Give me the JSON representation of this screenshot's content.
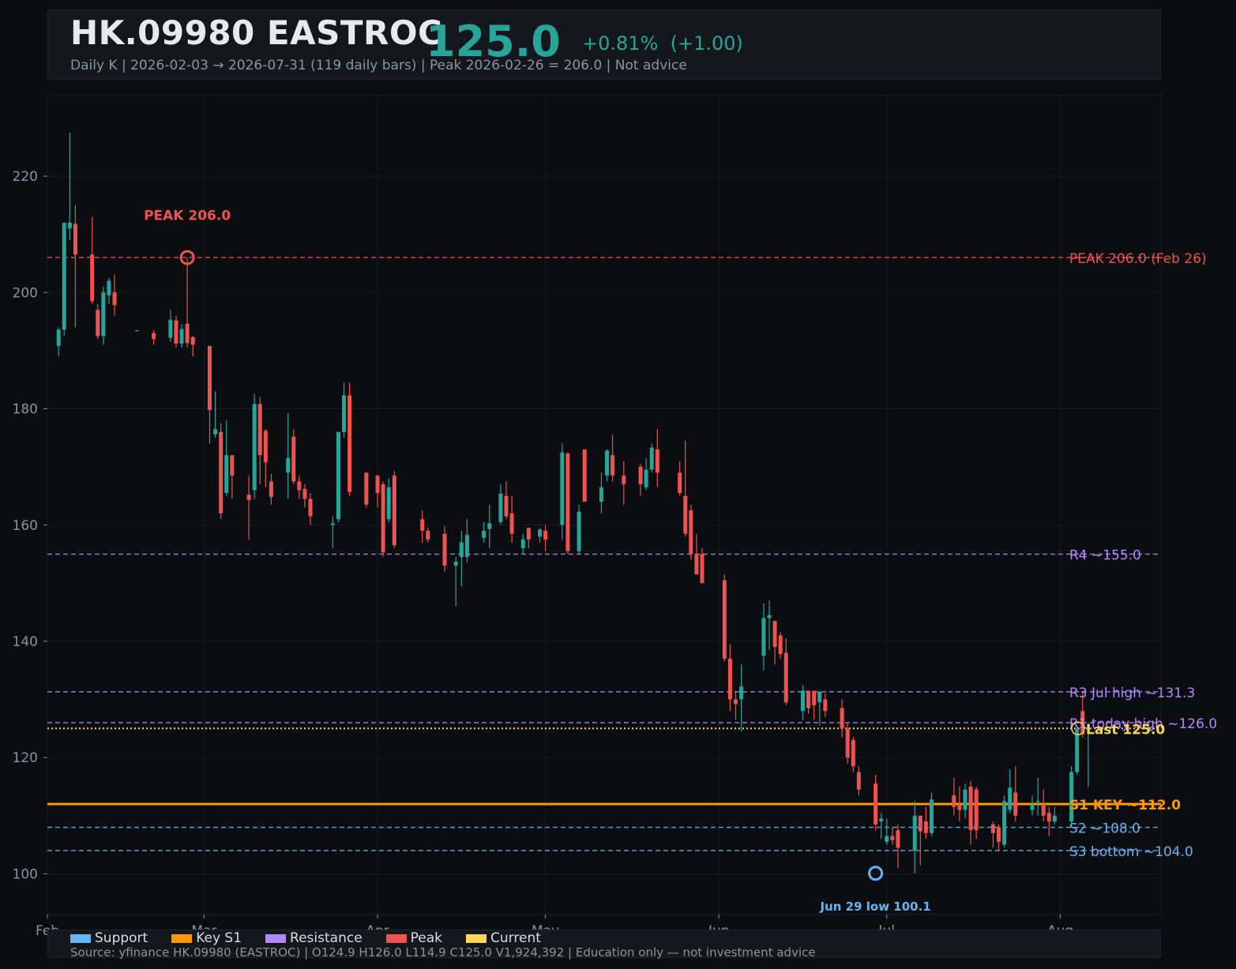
{
  "header": {
    "title": "HK.09980  EASTROC",
    "price": "125.0",
    "change": "+0.81%  (+1.00)",
    "subtitle": "Daily K  |  2026-02-03 → 2026-07-31 (119 daily bars)  |  Peak 2026-02-26 = 206.0  |  Not advice"
  },
  "footer": {
    "legend": [
      {
        "label": "Support",
        "color": "#64b5f6"
      },
      {
        "label": "Key S1",
        "color": "#ff9800"
      },
      {
        "label": "Resistance",
        "color": "#b388ff"
      },
      {
        "label": "Peak",
        "color": "#ef5350"
      },
      {
        "label": "Current",
        "color": "#ffd54f"
      }
    ],
    "source": "Source: yfinance HK.09980 (EASTROC)  |  O124.9  H126.0  L114.9  C125.0  V1,924,392  |  Education only — not investment advice"
  },
  "colors": {
    "up": "#26a69a",
    "down": "#ef5350",
    "support": "#64b5f6",
    "key": "#ff9800",
    "resistance": "#b388ff",
    "peak": "#ef5350",
    "current": "#ffd54f"
  },
  "chart_data": {
    "type": "candlestick",
    "ylim": [
      93,
      234
    ],
    "y_ticks": [
      100,
      120,
      140,
      160,
      180,
      200,
      220
    ],
    "x_range": [
      "2026-02-01",
      "2026-08-19"
    ],
    "x_ticks": [
      {
        "date": "2026-02-01",
        "label": "Feb"
      },
      {
        "date": "2026-03-01",
        "label": "Mar"
      },
      {
        "date": "2026-04-01",
        "label": "Apr"
      },
      {
        "date": "2026-05-01",
        "label": "May"
      },
      {
        "date": "2026-06-01",
        "label": "Jun"
      },
      {
        "date": "2026-07-01",
        "label": "Jul"
      },
      {
        "date": "2026-08-01",
        "label": "Aug"
      }
    ],
    "levels": [
      {
        "label": "PEAK 206.0 (Feb 26)",
        "value": 206.0,
        "kind": "peak",
        "style": "dashed"
      },
      {
        "label": "R4 ~155.0",
        "value": 155.0,
        "kind": "resistance",
        "style": "dashed"
      },
      {
        "label": "R3 Jul high ~131.3",
        "value": 131.3,
        "kind": "resistance",
        "style": "dashed"
      },
      {
        "label": "R1 today high ~126.0",
        "value": 126.0,
        "kind": "resistance",
        "style": "dashed"
      },
      {
        "label": "Last 125.0",
        "value": 125.0,
        "kind": "current",
        "style": "dotted"
      },
      {
        "label": "S1 KEY ~112.0",
        "value": 112.0,
        "kind": "key",
        "style": "solid"
      },
      {
        "label": "S2 ~108.0",
        "value": 108.0,
        "kind": "support",
        "style": "dashed"
      },
      {
        "label": "S3 bottom ~104.0",
        "value": 104.0,
        "kind": "support",
        "style": "dashed"
      }
    ],
    "annotations": [
      {
        "label": "PEAK 206.0",
        "date": "2026-02-26",
        "value": 206.0,
        "kind": "peak"
      },
      {
        "label": "Jun 29 low 100.1",
        "date": "2026-06-29",
        "value": 100.1,
        "kind": "support"
      }
    ],
    "candles": [
      {
        "d": "2026-02-03",
        "o": 190.8,
        "h": 194.0,
        "l": 189.0,
        "c": 193.6
      },
      {
        "d": "2026-02-04",
        "o": 193.6,
        "h": 212.0,
        "l": 192.5,
        "c": 212.0
      },
      {
        "d": "2026-02-05",
        "o": 211.0,
        "h": 227.5,
        "l": 209.0,
        "c": 212.0
      },
      {
        "d": "2026-02-06",
        "o": 211.8,
        "h": 215.0,
        "l": 194.0,
        "c": 206.5
      },
      {
        "d": "2026-02-09",
        "o": 206.5,
        "h": 213.0,
        "l": 198.0,
        "c": 198.5
      },
      {
        "d": "2026-02-10",
        "o": 197.0,
        "h": 198.0,
        "l": 192.0,
        "c": 192.5
      },
      {
        "d": "2026-02-11",
        "o": 192.5,
        "h": 201.0,
        "l": 191.0,
        "c": 200.0
      },
      {
        "d": "2026-02-12",
        "o": 199.5,
        "h": 202.5,
        "l": 198.0,
        "c": 202.0
      },
      {
        "d": "2026-02-13",
        "o": 200.0,
        "h": 203.0,
        "l": 196.0,
        "c": 197.8
      },
      {
        "d": "2026-02-17",
        "o": 193.5,
        "h": 193.5,
        "l": 193.4,
        "c": 193.5
      },
      {
        "d": "2026-02-20",
        "o": 193.0,
        "h": 193.5,
        "l": 191.0,
        "c": 192.0
      },
      {
        "d": "2026-02-23",
        "o": 192.2,
        "h": 197.0,
        "l": 191.5,
        "c": 195.3
      },
      {
        "d": "2026-02-24",
        "o": 195.2,
        "h": 196.0,
        "l": 190.5,
        "c": 191.2
      },
      {
        "d": "2026-02-25",
        "o": 191.2,
        "h": 194.5,
        "l": 190.5,
        "c": 193.7
      },
      {
        "d": "2026-02-26",
        "o": 194.6,
        "h": 206.0,
        "l": 190.5,
        "c": 191.3
      },
      {
        "d": "2026-02-27",
        "o": 192.3,
        "h": 192.5,
        "l": 189.0,
        "c": 191.0
      },
      {
        "d": "2026-03-02",
        "o": 190.8,
        "h": 190.8,
        "l": 174.0,
        "c": 179.8
      },
      {
        "d": "2026-03-03",
        "o": 175.6,
        "h": 183.0,
        "l": 175.0,
        "c": 176.5
      },
      {
        "d": "2026-03-04",
        "o": 176.0,
        "h": 177.5,
        "l": 161.0,
        "c": 162.0
      },
      {
        "d": "2026-03-05",
        "o": 165.5,
        "h": 178.0,
        "l": 165.0,
        "c": 172.0
      },
      {
        "d": "2026-03-06",
        "o": 172.0,
        "h": 172.0,
        "l": 164.5,
        "c": 168.5
      },
      {
        "d": "2026-03-09",
        "o": 165.2,
        "h": 168.5,
        "l": 157.5,
        "c": 164.3
      },
      {
        "d": "2026-03-10",
        "o": 166.0,
        "h": 182.5,
        "l": 164.5,
        "c": 180.8
      },
      {
        "d": "2026-03-11",
        "o": 180.8,
        "h": 182.0,
        "l": 167.0,
        "c": 172.0
      },
      {
        "d": "2026-03-12",
        "o": 176.2,
        "h": 176.5,
        "l": 166.5,
        "c": 170.8
      },
      {
        "d": "2026-03-13",
        "o": 167.5,
        "h": 168.8,
        "l": 163.5,
        "c": 164.8
      },
      {
        "d": "2026-03-16",
        "o": 169.0,
        "h": 179.3,
        "l": 164.5,
        "c": 171.5
      },
      {
        "d": "2026-03-17",
        "o": 175.2,
        "h": 176.5,
        "l": 167.0,
        "c": 167.5
      },
      {
        "d": "2026-03-18",
        "o": 167.5,
        "h": 168.5,
        "l": 164.5,
        "c": 166.0
      },
      {
        "d": "2026-03-19",
        "o": 166.2,
        "h": 167.0,
        "l": 163.0,
        "c": 164.5
      },
      {
        "d": "2026-03-20",
        "o": 164.5,
        "h": 165.5,
        "l": 160.0,
        "c": 161.5
      },
      {
        "d": "2026-03-24",
        "o": 160.0,
        "h": 161.5,
        "l": 156.0,
        "c": 160.3
      },
      {
        "d": "2026-03-25",
        "o": 161.0,
        "h": 176.0,
        "l": 160.5,
        "c": 176.0
      },
      {
        "d": "2026-03-26",
        "o": 176.0,
        "h": 184.5,
        "l": 175.0,
        "c": 182.3
      },
      {
        "d": "2026-03-27",
        "o": 182.3,
        "h": 184.5,
        "l": 165.0,
        "c": 165.7
      },
      {
        "d": "2026-03-30",
        "o": 169.0,
        "h": 169.0,
        "l": 163.0,
        "c": 163.5
      },
      {
        "d": "2026-04-01",
        "o": 168.5,
        "h": 168.5,
        "l": 163.0,
        "c": 165.5
      },
      {
        "d": "2026-04-02",
        "o": 167.0,
        "h": 167.5,
        "l": 154.5,
        "c": 155.3
      },
      {
        "d": "2026-04-03",
        "o": 161.0,
        "h": 168.0,
        "l": 160.5,
        "c": 166.5
      },
      {
        "d": "2026-04-04",
        "o": 168.5,
        "h": 169.3,
        "l": 156.0,
        "c": 156.5
      },
      {
        "d": "2026-04-09",
        "o": 161.0,
        "h": 162.5,
        "l": 157.0,
        "c": 159.0
      },
      {
        "d": "2026-04-10",
        "o": 159.0,
        "h": 159.5,
        "l": 157.0,
        "c": 157.5
      },
      {
        "d": "2026-04-13",
        "o": 158.5,
        "h": 159.8,
        "l": 152.0,
        "c": 153.0
      },
      {
        "d": "2026-04-15",
        "o": 153.0,
        "h": 154.5,
        "l": 146.0,
        "c": 153.7
      },
      {
        "d": "2026-04-16",
        "o": 154.5,
        "h": 159.0,
        "l": 149.5,
        "c": 157.0
      },
      {
        "d": "2026-04-17",
        "o": 154.5,
        "h": 161.0,
        "l": 153.5,
        "c": 158.3
      },
      {
        "d": "2026-04-20",
        "o": 157.8,
        "h": 160.5,
        "l": 157.0,
        "c": 159.0
      },
      {
        "d": "2026-04-21",
        "o": 159.3,
        "h": 163.5,
        "l": 156.0,
        "c": 160.3
      },
      {
        "d": "2026-04-23",
        "o": 160.5,
        "h": 167.0,
        "l": 160.0,
        "c": 165.4
      },
      {
        "d": "2026-04-24",
        "o": 165.0,
        "h": 167.5,
        "l": 161.0,
        "c": 161.5
      },
      {
        "d": "2026-04-25",
        "o": 162.0,
        "h": 165.0,
        "l": 157.0,
        "c": 158.5
      },
      {
        "d": "2026-04-27",
        "o": 156.0,
        "h": 158.5,
        "l": 155.0,
        "c": 157.5
      },
      {
        "d": "2026-04-28",
        "o": 159.5,
        "h": 159.5,
        "l": 156.0,
        "c": 157.5
      },
      {
        "d": "2026-04-30",
        "o": 158.0,
        "h": 159.5,
        "l": 157.0,
        "c": 159.2
      },
      {
        "d": "2026-05-01",
        "o": 159.0,
        "h": 160.0,
        "l": 155.5,
        "c": 157.5
      },
      {
        "d": "2026-05-04",
        "o": 160.0,
        "h": 174.0,
        "l": 157.5,
        "c": 172.5
      },
      {
        "d": "2026-05-05",
        "o": 172.3,
        "h": 172.5,
        "l": 155.0,
        "c": 155.5
      },
      {
        "d": "2026-05-07",
        "o": 155.5,
        "h": 163.5,
        "l": 155.0,
        "c": 162.3
      },
      {
        "d": "2026-05-08",
        "o": 173.0,
        "h": 173.0,
        "l": 164.0,
        "c": 164.0
      },
      {
        "d": "2026-05-11",
        "o": 164.0,
        "h": 169.0,
        "l": 162.0,
        "c": 166.5
      },
      {
        "d": "2026-05-12",
        "o": 168.5,
        "h": 173.0,
        "l": 167.5,
        "c": 172.8
      },
      {
        "d": "2026-05-13",
        "o": 172.0,
        "h": 175.5,
        "l": 167.5,
        "c": 168.5
      },
      {
        "d": "2026-05-15",
        "o": 168.5,
        "h": 171.0,
        "l": 163.5,
        "c": 167.0
      },
      {
        "d": "2026-05-18",
        "o": 170.0,
        "h": 170.5,
        "l": 165.0,
        "c": 167.0
      },
      {
        "d": "2026-05-19",
        "o": 166.5,
        "h": 171.5,
        "l": 166.0,
        "c": 169.5
      },
      {
        "d": "2026-05-20",
        "o": 169.5,
        "h": 174.0,
        "l": 169.0,
        "c": 173.3
      },
      {
        "d": "2026-05-21",
        "o": 173.0,
        "h": 176.5,
        "l": 166.5,
        "c": 169.0
      },
      {
        "d": "2026-05-25",
        "o": 169.0,
        "h": 171.0,
        "l": 165.0,
        "c": 165.5
      },
      {
        "d": "2026-05-26",
        "o": 165.0,
        "h": 174.5,
        "l": 158.0,
        "c": 158.5
      },
      {
        "d": "2026-05-27",
        "o": 162.5,
        "h": 163.5,
        "l": 154.0,
        "c": 155.0
      },
      {
        "d": "2026-05-28",
        "o": 155.0,
        "h": 158.5,
        "l": 151.5,
        "c": 151.5
      },
      {
        "d": "2026-05-29",
        "o": 155.0,
        "h": 156.0,
        "l": 150.0,
        "c": 150.0
      },
      {
        "d": "2026-06-02",
        "o": 150.5,
        "h": 151.5,
        "l": 136.5,
        "c": 137.0
      },
      {
        "d": "2026-06-03",
        "o": 137.0,
        "h": 139.5,
        "l": 128.0,
        "c": 130.0
      },
      {
        "d": "2026-06-04",
        "o": 130.0,
        "h": 131.5,
        "l": 126.5,
        "c": 129.2
      },
      {
        "d": "2026-06-05",
        "o": 130.0,
        "h": 136.0,
        "l": 124.5,
        "c": 132.2
      },
      {
        "d": "2026-06-09",
        "o": 137.5,
        "h": 146.5,
        "l": 135.0,
        "c": 144.0
      },
      {
        "d": "2026-06-10",
        "o": 144.0,
        "h": 147.0,
        "l": 138.5,
        "c": 144.5
      },
      {
        "d": "2026-06-11",
        "o": 143.5,
        "h": 143.5,
        "l": 136.0,
        "c": 139.0
      },
      {
        "d": "2026-06-12",
        "o": 141.0,
        "h": 141.5,
        "l": 137.0,
        "c": 137.8
      },
      {
        "d": "2026-06-13",
        "o": 138.0,
        "h": 140.5,
        "l": 129.0,
        "c": 129.5
      },
      {
        "d": "2026-06-16",
        "o": 128.0,
        "h": 132.5,
        "l": 126.5,
        "c": 131.5
      },
      {
        "d": "2026-06-17",
        "o": 131.5,
        "h": 131.5,
        "l": 127.5,
        "c": 128.5
      },
      {
        "d": "2026-06-18",
        "o": 131.5,
        "h": 131.5,
        "l": 126.5,
        "c": 129.0
      },
      {
        "d": "2026-06-19",
        "o": 129.5,
        "h": 131.5,
        "l": 125.5,
        "c": 131.3
      },
      {
        "d": "2026-06-20",
        "o": 130.0,
        "h": 131.0,
        "l": 127.0,
        "c": 128.0
      },
      {
        "d": "2026-06-23",
        "o": 128.5,
        "h": 130.0,
        "l": 123.5,
        "c": 125.0
      },
      {
        "d": "2026-06-24",
        "o": 125.0,
        "h": 126.0,
        "l": 119.0,
        "c": 120.0
      },
      {
        "d": "2026-06-25",
        "o": 123.0,
        "h": 123.5,
        "l": 117.5,
        "c": 118.5
      },
      {
        "d": "2026-06-26",
        "o": 117.5,
        "h": 118.5,
        "l": 113.5,
        "c": 114.5
      },
      {
        "d": "2026-06-29",
        "o": 115.5,
        "h": 117.0,
        "l": 107.5,
        "c": 108.5
      },
      {
        "d": "2026-06-30",
        "o": 109.0,
        "h": 110.5,
        "l": 106.0,
        "c": 109.5
      },
      {
        "d": "2026-07-01",
        "o": 105.5,
        "h": 109.5,
        "l": 105.0,
        "c": 106.5
      },
      {
        "d": "2026-07-02",
        "o": 106.5,
        "h": 108.0,
        "l": 105.0,
        "c": 105.8
      },
      {
        "d": "2026-07-03",
        "o": 107.5,
        "h": 108.5,
        "l": 101.0,
        "c": 104.5
      },
      {
        "d": "2026-07-06",
        "o": 104.0,
        "h": 112.5,
        "l": 100.1,
        "c": 110.0
      },
      {
        "d": "2026-07-07",
        "o": 110.0,
        "h": 110.0,
        "l": 101.5,
        "c": 107.3
      },
      {
        "d": "2026-07-08",
        "o": 109.0,
        "h": 111.5,
        "l": 106.0,
        "c": 107.0
      },
      {
        "d": "2026-07-09",
        "o": 107.0,
        "h": 114.0,
        "l": 106.5,
        "c": 112.8
      },
      {
        "d": "2026-07-13",
        "o": 113.5,
        "h": 116.5,
        "l": 110.0,
        "c": 111.5
      },
      {
        "d": "2026-07-14",
        "o": 112.0,
        "h": 115.0,
        "l": 109.0,
        "c": 111.0
      },
      {
        "d": "2026-07-15",
        "o": 111.0,
        "h": 115.5,
        "l": 109.5,
        "c": 114.5
      },
      {
        "d": "2026-07-16",
        "o": 115.0,
        "h": 116.0,
        "l": 105.0,
        "c": 107.5
      },
      {
        "d": "2026-07-17",
        "o": 114.5,
        "h": 115.0,
        "l": 106.0,
        "c": 107.5
      },
      {
        "d": "2026-07-20",
        "o": 108.5,
        "h": 109.0,
        "l": 104.5,
        "c": 107.0
      },
      {
        "d": "2026-07-21",
        "o": 108.0,
        "h": 108.5,
        "l": 104.0,
        "c": 105.5
      },
      {
        "d": "2026-07-22",
        "o": 105.0,
        "h": 113.5,
        "l": 104.5,
        "c": 112.5
      },
      {
        "d": "2026-07-23",
        "o": 111.0,
        "h": 118.0,
        "l": 110.5,
        "c": 114.8
      },
      {
        "d": "2026-07-24",
        "o": 114.0,
        "h": 118.5,
        "l": 109.0,
        "c": 110.0
      },
      {
        "d": "2026-07-27",
        "o": 111.0,
        "h": 113.5,
        "l": 110.0,
        "c": 112.0
      },
      {
        "d": "2026-07-28",
        "o": 112.5,
        "h": 116.5,
        "l": 110.0,
        "c": 112.5
      },
      {
        "d": "2026-07-29",
        "o": 112.0,
        "h": 114.5,
        "l": 109.0,
        "c": 110.0
      },
      {
        "d": "2026-07-30",
        "o": 110.5,
        "h": 111.5,
        "l": 106.5,
        "c": 109.0
      },
      {
        "d": "2026-07-31",
        "o": 109.0,
        "h": 111.5,
        "l": 108.5,
        "c": 110.0
      },
      {
        "d": "2026-08-03",
        "o": 109.0,
        "h": 118.5,
        "l": 108.5,
        "c": 117.5
      },
      {
        "d": "2026-08-04",
        "o": 117.5,
        "h": 125.5,
        "l": 117.0,
        "c": 125.0
      },
      {
        "d": "2026-08-05",
        "o": 128.0,
        "h": 131.3,
        "l": 123.5,
        "c": 124.0
      },
      {
        "d": "2026-08-06",
        "o": 124.9,
        "h": 126.0,
        "l": 114.9,
        "c": 125.0
      }
    ]
  }
}
